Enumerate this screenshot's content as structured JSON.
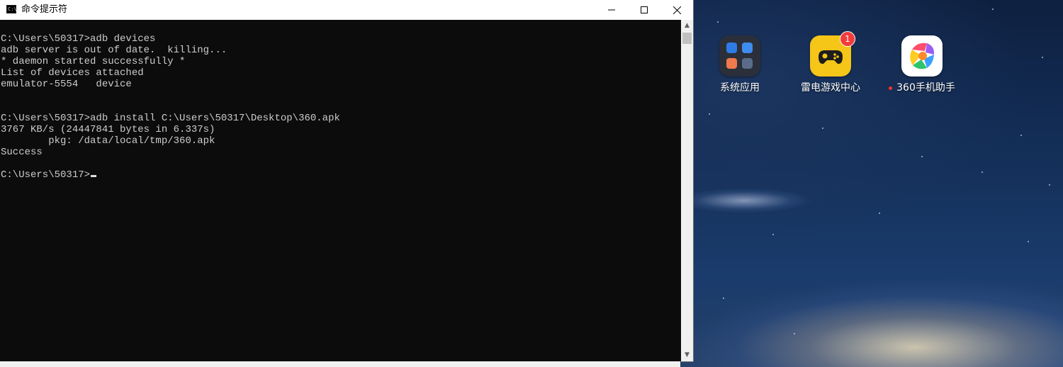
{
  "window": {
    "title": "命令提示符",
    "icon": "console-icon",
    "icon_text": "C:\\."
  },
  "terminal": {
    "lines": [
      "C:\\Users\\50317>adb devices",
      "adb server is out of date.  killing...",
      "* daemon started successfully *",
      "List of devices attached",
      "emulator-5554   device",
      "",
      "",
      "C:\\Users\\50317>adb install C:\\Users\\50317\\Desktop\\360.apk",
      "3767 KB/s (24447841 bytes in 6.337s)",
      "        pkg: /data/local/tmp/360.apk",
      "Success",
      "",
      "C:\\Users\\50317>"
    ]
  },
  "desktop": {
    "apps": [
      {
        "label": "系统应用",
        "icon": "system-apps-folder-icon"
      },
      {
        "label": "雷电游戏中心",
        "icon": "gamepad-icon",
        "badge": "1"
      },
      {
        "label": "360手机助手",
        "icon": "360-assistant-icon",
        "new_dot": true
      }
    ]
  },
  "colors": {
    "terminal_bg": "#0c0c0c",
    "terminal_text": "#cccccc",
    "titlebar_bg": "#ffffff",
    "game_center": "#f5c518",
    "badge": "#f23b3b"
  }
}
